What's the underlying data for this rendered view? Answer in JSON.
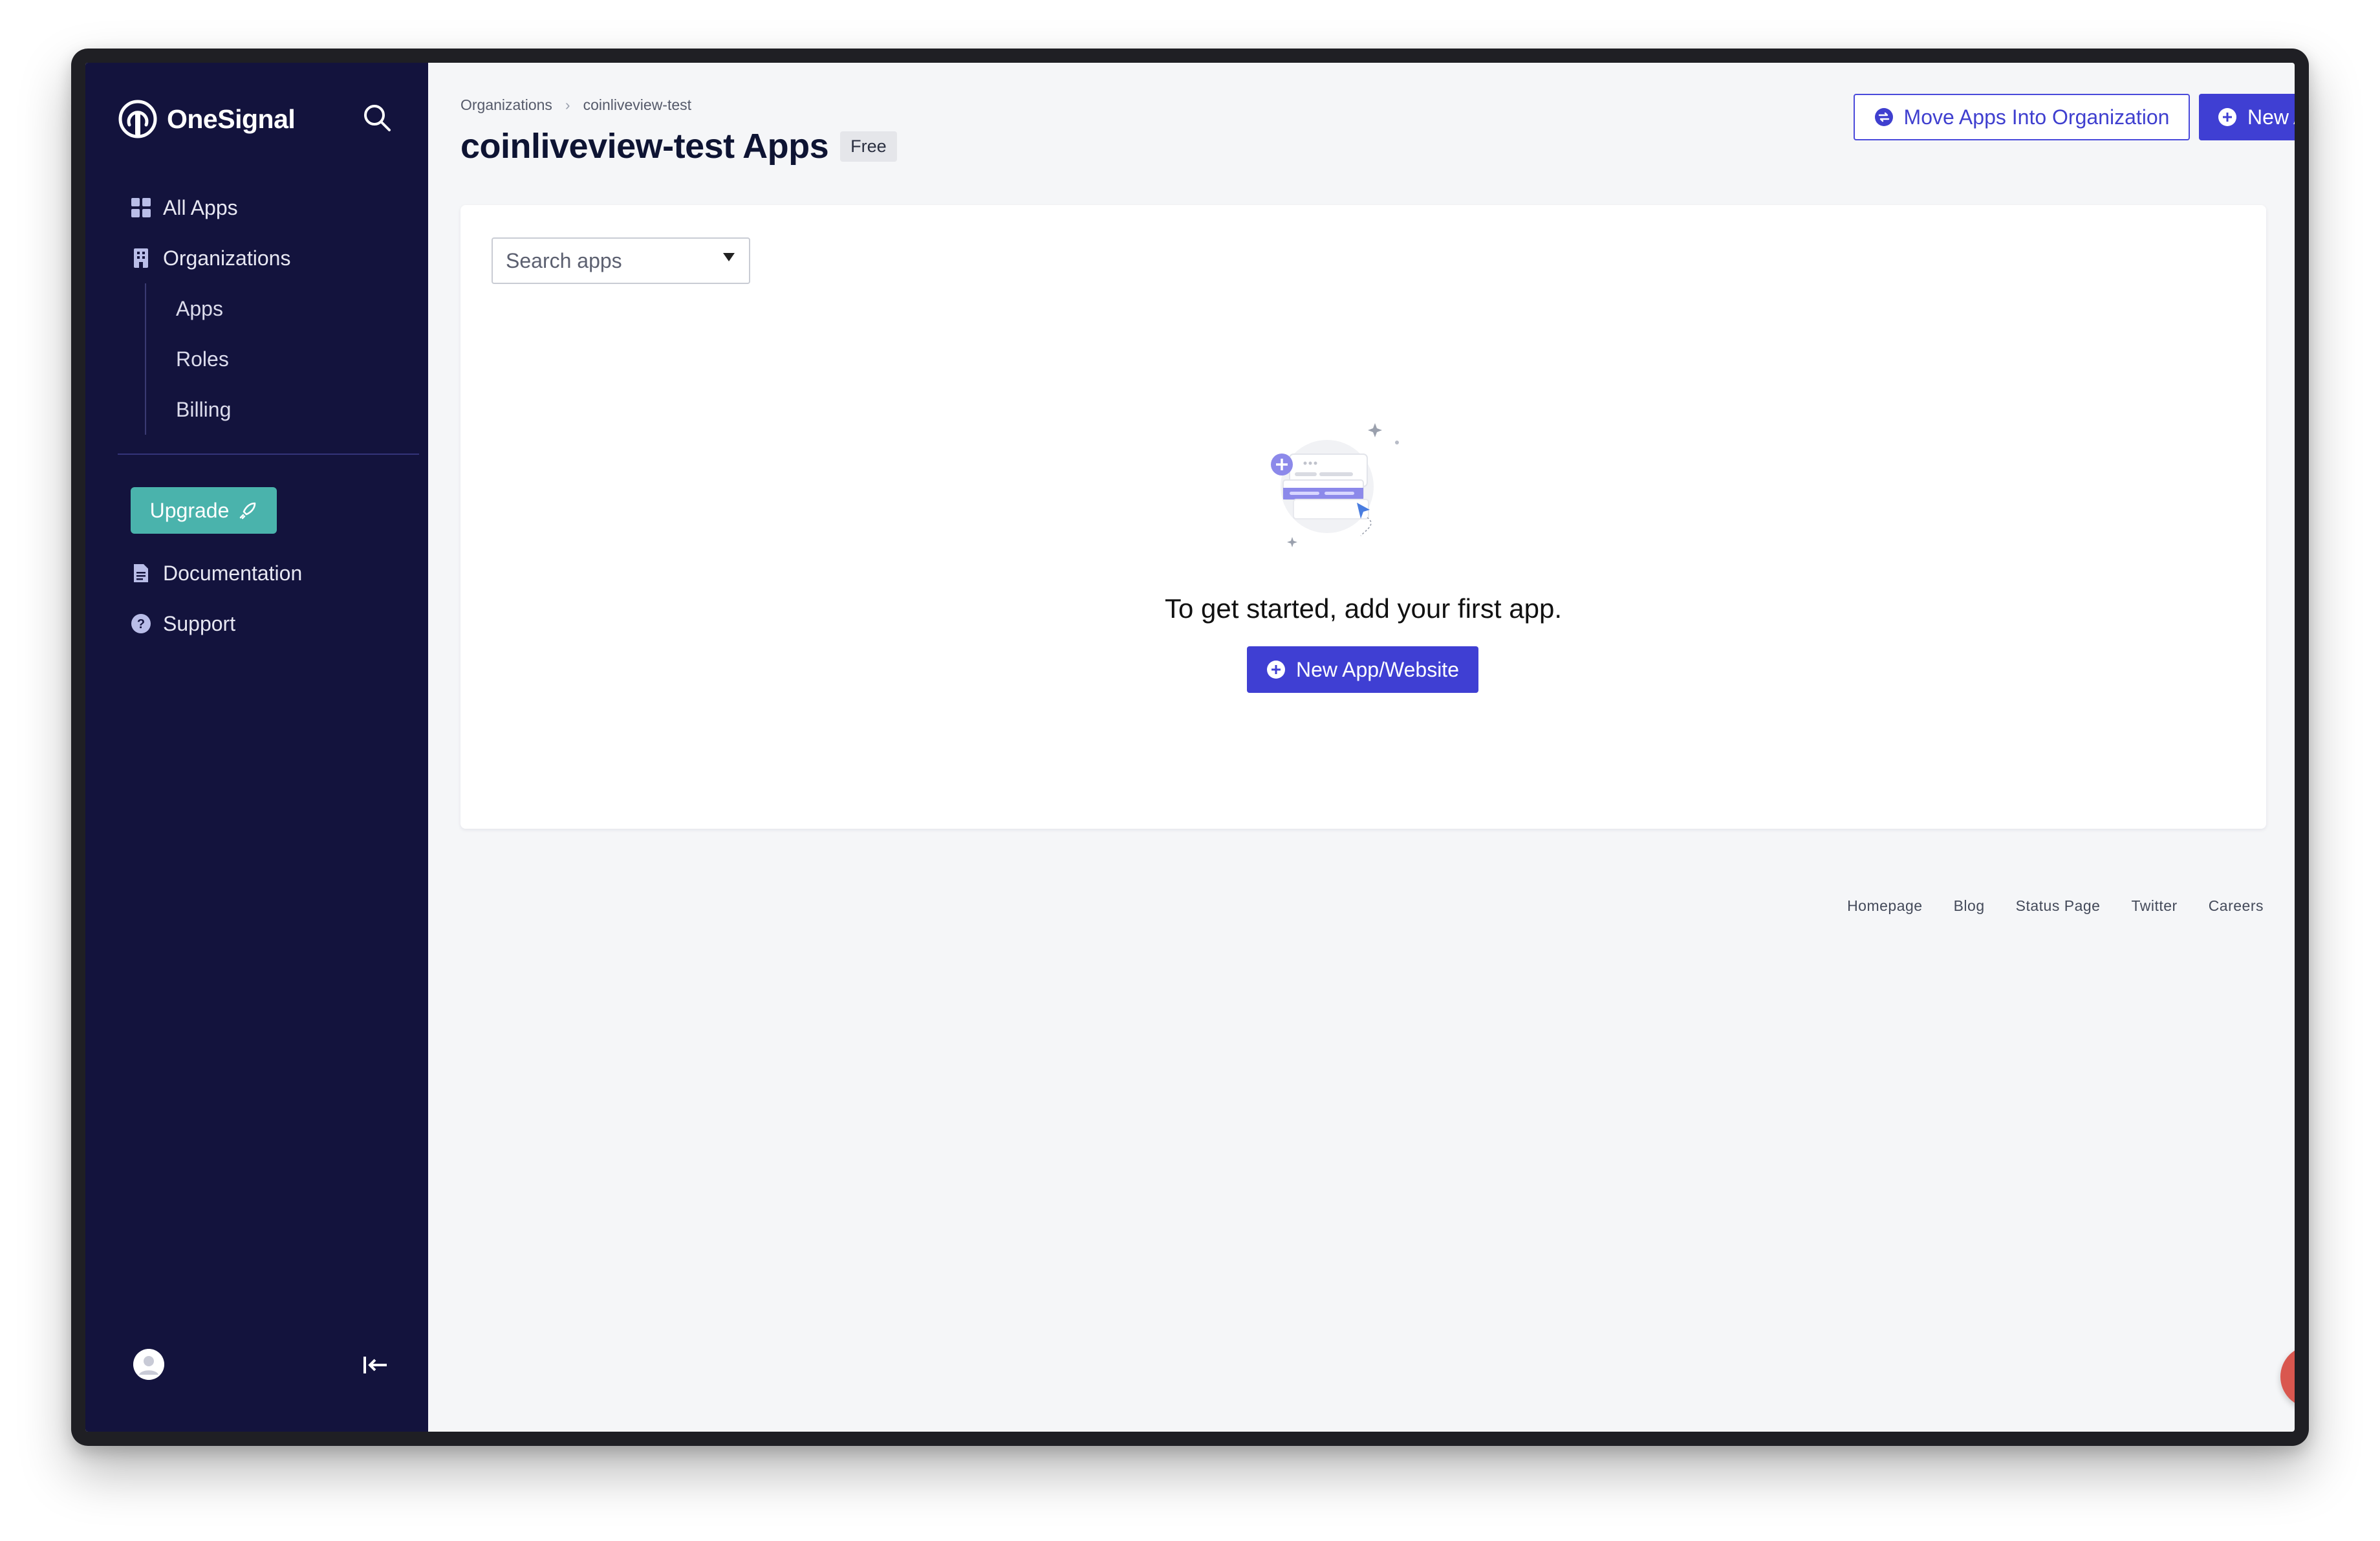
{
  "brand": {
    "name": "OneSignal"
  },
  "sidebar": {
    "nav": [
      {
        "label": "All Apps",
        "icon": "grid-icon"
      },
      {
        "label": "Organizations",
        "icon": "building-icon"
      }
    ],
    "org_sub": [
      "Apps",
      "Roles",
      "Billing"
    ],
    "upgrade_label": "Upgrade",
    "nav2": [
      {
        "label": "Documentation",
        "icon": "document-icon"
      },
      {
        "label": "Support",
        "icon": "help-icon"
      }
    ]
  },
  "breadcrumb": [
    "Organizations",
    "coinliveview-test"
  ],
  "header": {
    "title": "coinliveview-test Apps",
    "plan_badge": "Free",
    "move_apps_label": "Move Apps Into Organization",
    "new_app_label": "New App"
  },
  "card": {
    "search_placeholder": "Search apps",
    "empty_message": "To get started, add your first app.",
    "new_app_website_label": "New App/Website"
  },
  "footer": [
    "Homepage",
    "Blog",
    "Status Page",
    "Twitter",
    "Careers"
  ],
  "colors": {
    "sidebar_bg": "#13133d",
    "primary": "#3f3fd3",
    "upgrade": "#4ab3ac",
    "chat": "#d9574f"
  }
}
